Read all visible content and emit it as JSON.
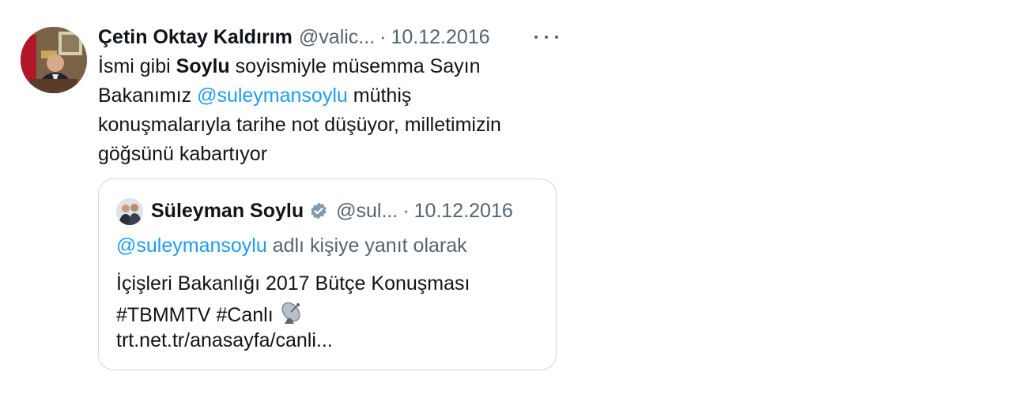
{
  "tweet": {
    "author_name": "Çetin Oktay Kaldırım",
    "author_handle": "@valic...",
    "separator": "·",
    "date": "10.12.2016",
    "more_icon": "more-horizontal-icon",
    "body": {
      "line1_a": "İsmi gibi ",
      "line1_bold": "Soylu",
      "line1_b": " soyismiyle müsemma Sayın",
      "line2_a": "Bakanımız ",
      "line2_mention": "@suleymansoylu",
      "line2_b": " müthiş",
      "line3": "konuşmalarıyla tarihe not düşüyor, milletimizin",
      "line4": "göğsünü kabartıyor"
    },
    "accent_color": "#1d9bf0"
  },
  "quote": {
    "author_name": "Süleyman Soylu",
    "verified_icon": "verified-badge-icon",
    "author_handle": "@sul...",
    "separator": "·",
    "date": "10.12.2016",
    "reply_mention": "@suleymansoylu",
    "reply_suffix": " adlı kişiye yanıt olarak",
    "text_line1": "İçişleri Bakanlığı 2017 Bütçe Konuşması",
    "text_line2": "#TBMMTV #Canlı",
    "satellite_icon": "satellite-dish-icon",
    "link": "trt.net.tr/anasayfa/canli..."
  }
}
